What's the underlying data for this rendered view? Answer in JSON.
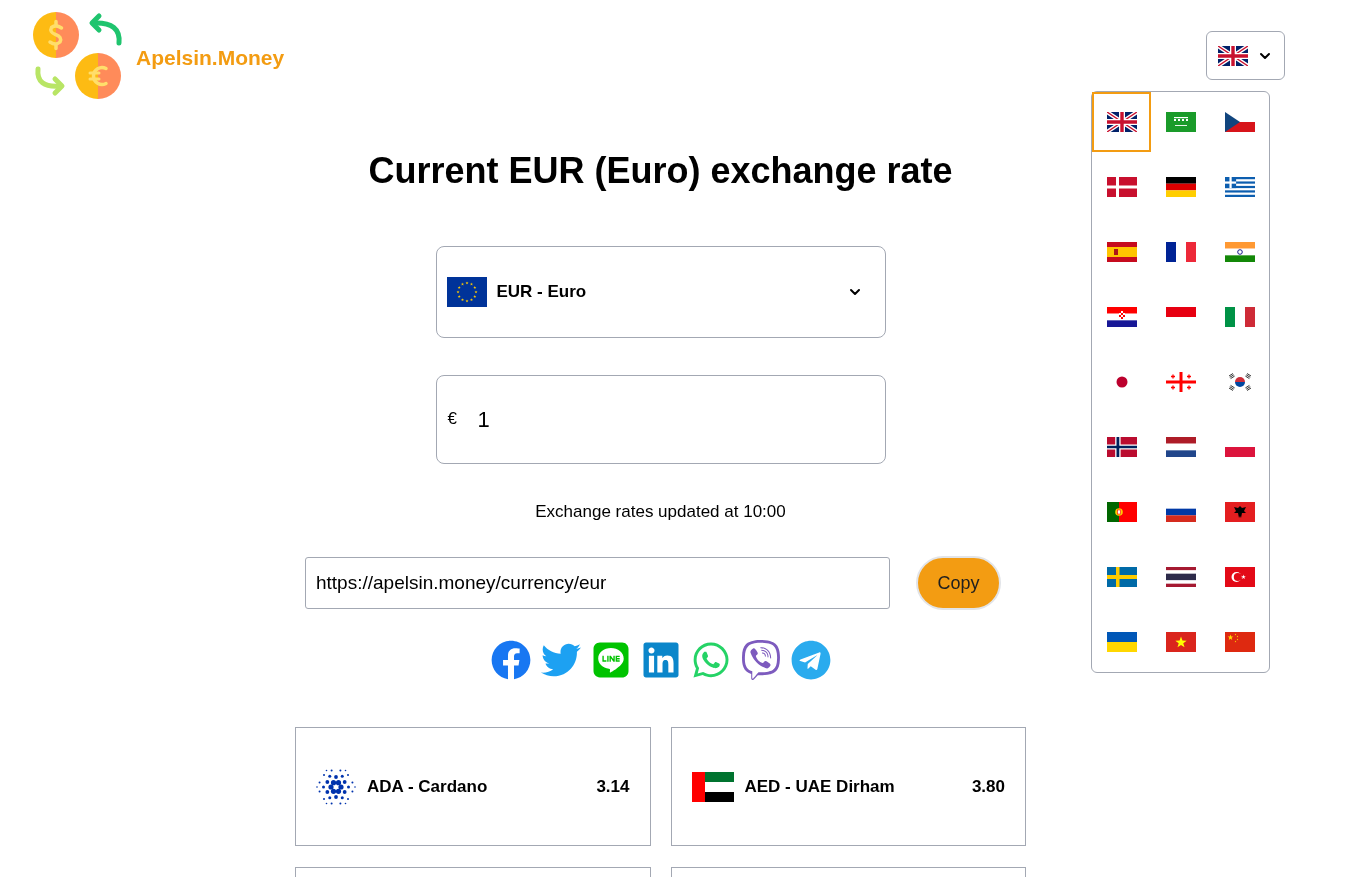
{
  "header": {
    "logo_text": "Apelsin.Money"
  },
  "language_menu": {
    "expanded": true,
    "options": [
      {
        "selected": true
      },
      {
        "selected": false
      },
      {
        "selected": false
      },
      {
        "selected": false
      },
      {
        "selected": false
      },
      {
        "selected": false
      },
      {
        "selected": false
      },
      {
        "selected": false
      },
      {
        "selected": false
      },
      {
        "selected": false
      },
      {
        "selected": false
      },
      {
        "selected": false
      },
      {
        "selected": false
      },
      {
        "selected": false
      },
      {
        "selected": false
      },
      {
        "selected": false
      },
      {
        "selected": false
      },
      {
        "selected": false
      },
      {
        "selected": false
      },
      {
        "selected": false
      },
      {
        "selected": false
      },
      {
        "selected": false
      },
      {
        "selected": false
      },
      {
        "selected": false
      },
      {
        "selected": false
      },
      {
        "selected": false
      },
      {
        "selected": false
      }
    ]
  },
  "title": "Current EUR (Euro) exchange rate",
  "currency_select": {
    "value": "EUR - Euro"
  },
  "amount": {
    "symbol": "€",
    "value": "1"
  },
  "update_note": "Exchange rates updated at 10:00",
  "share": {
    "url": "https://apelsin.money/currency/eur",
    "copy_label": "Copy"
  },
  "rate_cards": [
    {
      "name": "ADA - Cardano",
      "rate": "3.14"
    },
    {
      "name": "AED - UAE Dirham",
      "rate": "3.80"
    }
  ]
}
